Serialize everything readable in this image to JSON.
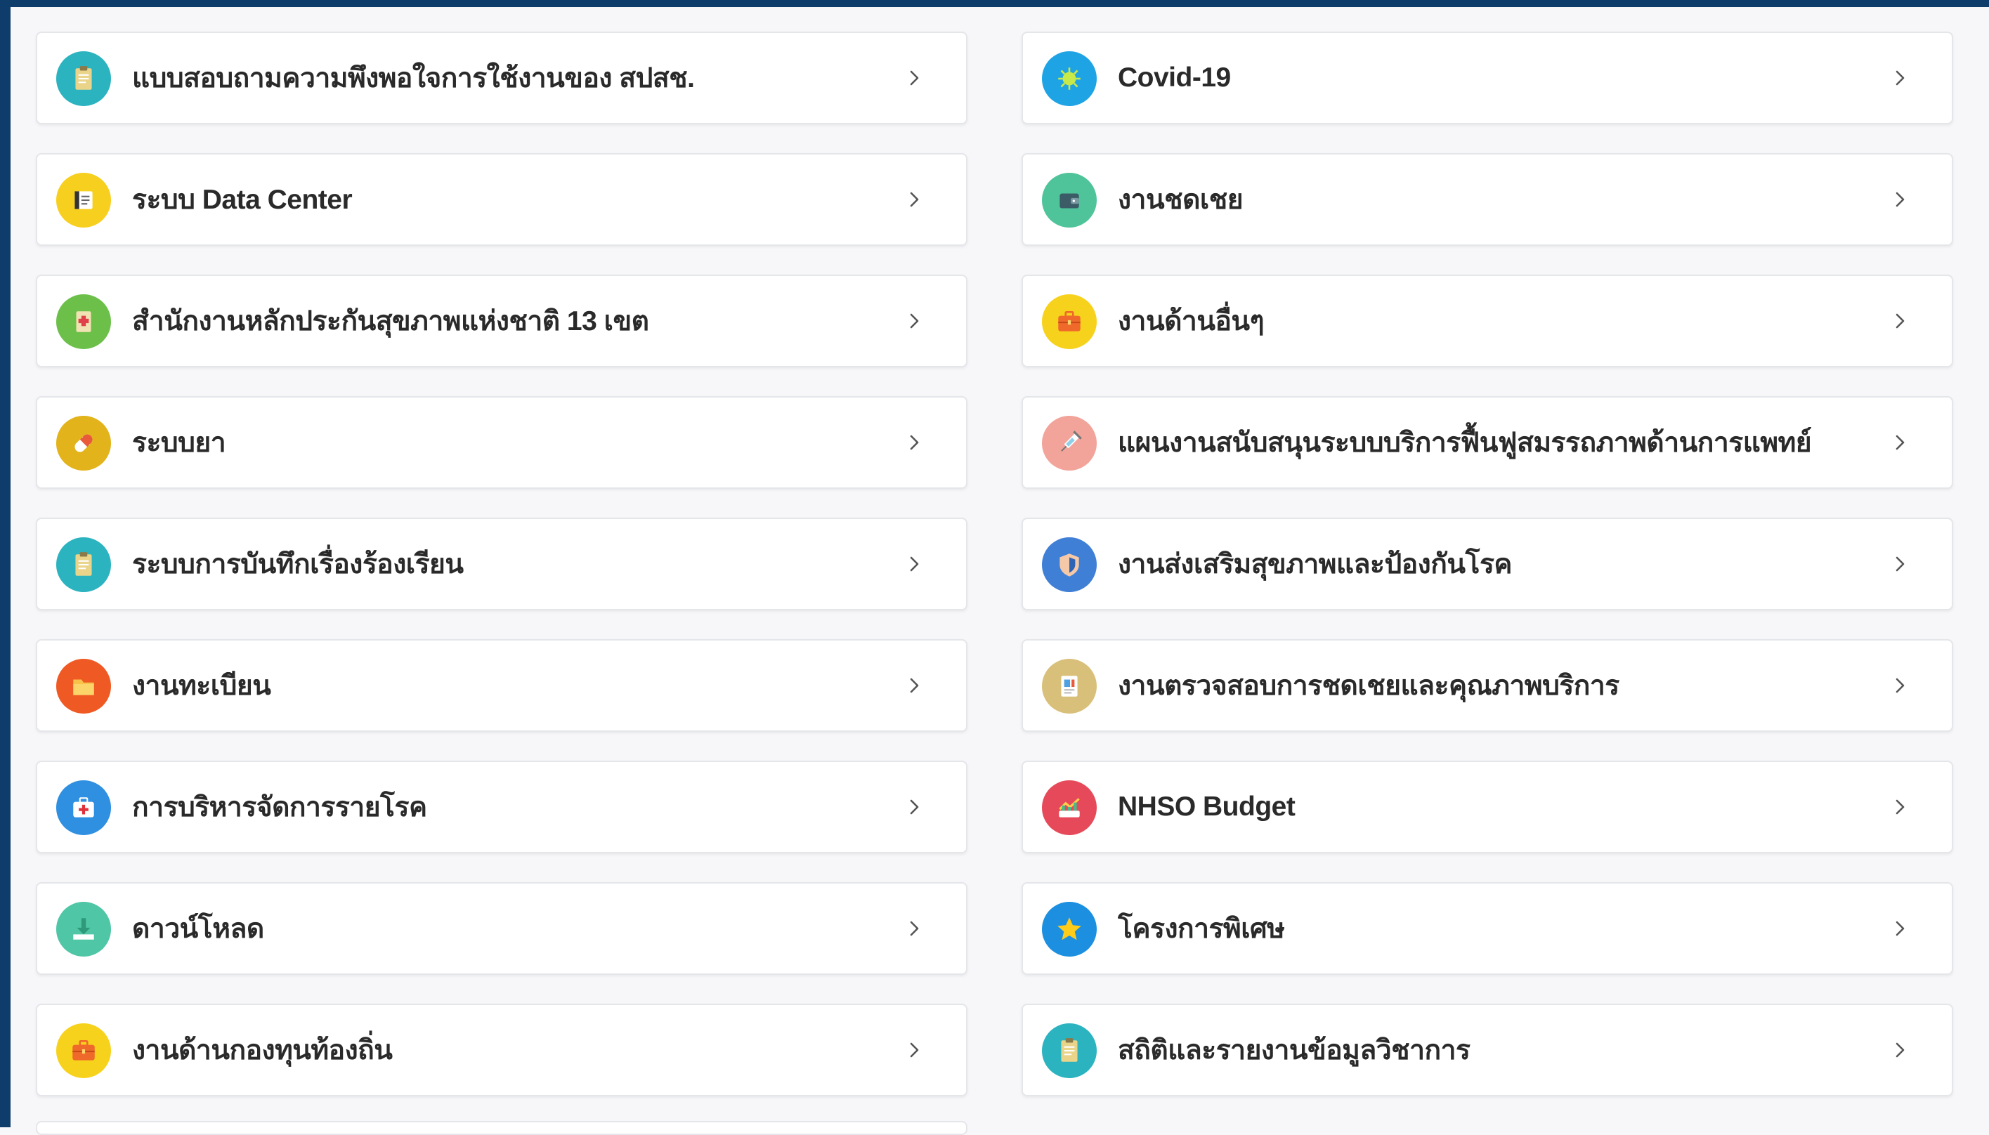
{
  "colors": {
    "frame": "#0e3d6b",
    "background": "#f7f7f9",
    "card": "#ffffff",
    "text": "#2a2a2a",
    "chevron": "#555555"
  },
  "menu": {
    "left": [
      {
        "label": "แบบสอบถามความพึงพอใจการใช้งานของ สปสช.",
        "icon": "clipboard-icon",
        "icon_bg": "#2bb3c0",
        "icon_fg": "#e9d48a"
      },
      {
        "label": "ระบบ Data Center",
        "icon": "document-icon",
        "icon_bg": "#f7cf1e",
        "icon_fg": "#ffffff"
      },
      {
        "label": "สำนักงานหลักประกันสุขภาพแห่งชาติ 13 เขต",
        "icon": "medical-report-icon",
        "icon_bg": "#6cc04a",
        "icon_fg": "#f1e2b3"
      },
      {
        "label": "ระบบยา",
        "icon": "pill-icon",
        "icon_bg": "#e2b31a",
        "icon_fg": "#ffffff"
      },
      {
        "label": "ระบบการบันทึกเรื่องร้องเรียน",
        "icon": "clipboard-icon",
        "icon_bg": "#2bb3c0",
        "icon_fg": "#e9d48a"
      },
      {
        "label": "งานทะเบียน",
        "icon": "folder-icon",
        "icon_bg": "#ef5a24",
        "icon_fg": "#f8c24a"
      },
      {
        "label": "การบริหารจัดการรายโรค",
        "icon": "first-aid-kit-icon",
        "icon_bg": "#2f8fe0",
        "icon_fg": "#ffffff"
      },
      {
        "label": "ดาวน์โหลด",
        "icon": "download-icon",
        "icon_bg": "#4fc6a5",
        "icon_fg": "#ffffff"
      },
      {
        "label": "งานด้านกองทุนท้องถิ่น",
        "icon": "briefcase-icon",
        "icon_bg": "#f7d21d",
        "icon_fg": "#ef6a2a"
      }
    ],
    "right": [
      {
        "label": "Covid-19",
        "icon": "virus-icon",
        "icon_bg": "#1ea3e5",
        "icon_fg": "#c8e94a"
      },
      {
        "label": "งานชดเชย",
        "icon": "wallet-icon",
        "icon_bg": "#4fc49b",
        "icon_fg": "#3b5b66"
      },
      {
        "label": "งานด้านอื่นๆ",
        "icon": "briefcase-icon",
        "icon_bg": "#f7d21d",
        "icon_fg": "#ef6a2a"
      },
      {
        "label": "แผนงานสนับสนุนระบบบริการฟื้นฟูสมรรถภาพด้านการแพทย์",
        "icon": "syringe-icon",
        "icon_bg": "#f2a49a",
        "icon_fg": "#ffffff"
      },
      {
        "label": "งานส่งเสริมสุขภาพและป้องกันโรค",
        "icon": "shield-icon",
        "icon_bg": "#3f7fd6",
        "icon_fg": "#f5c9a8"
      },
      {
        "label": "งานตรวจสอบการชดเชยและคุณภาพบริการ",
        "icon": "report-icon",
        "icon_bg": "#d9c07a",
        "icon_fg": "#ffffff"
      },
      {
        "label": "NHSO Budget",
        "icon": "budget-chart-icon",
        "icon_bg": "#e64a5a",
        "icon_fg": "#ffffff"
      },
      {
        "label": "โครงการพิเศษ",
        "icon": "star-icon",
        "icon_bg": "#1c8fe0",
        "icon_fg": "#ffcc1a"
      },
      {
        "label": "สถิติและรายงานข้อมูลวิชาการ",
        "icon": "clipboard-icon",
        "icon_bg": "#2bb3c0",
        "icon_fg": "#e9d48a"
      }
    ]
  }
}
